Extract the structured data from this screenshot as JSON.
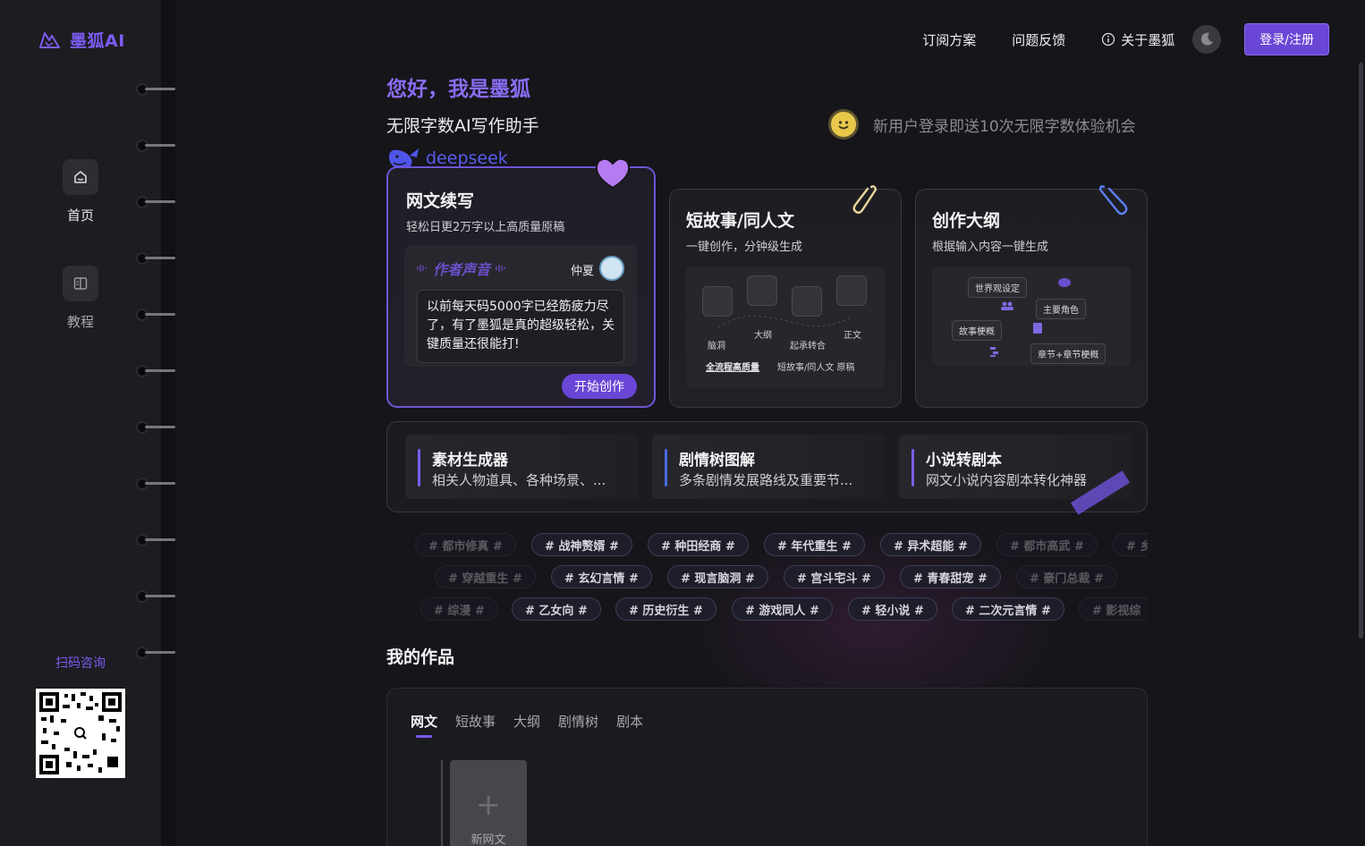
{
  "app": {
    "name": "墨狐AI"
  },
  "sidebar": {
    "items": [
      {
        "label": "首页",
        "icon": "home-icon"
      },
      {
        "label": "教程",
        "icon": "book-icon"
      }
    ],
    "qr_label": "扫码咨询"
  },
  "topnav": {
    "subscribe": "订阅方案",
    "feedback": "问题反馈",
    "about": "关于墨狐",
    "login": "登录/注册"
  },
  "hero": {
    "greeting": "您好，我是墨狐",
    "subtitle": "无限字数AI写作助手",
    "promo": "新用户登录即送10次无限字数体验机会",
    "badge": "deepseek"
  },
  "cards": {
    "webnovel": {
      "title": "网文续写",
      "desc": "轻松日更2万字以上高质量原稿",
      "voice_title": "作者声音",
      "voice_author": "仲夏",
      "voice_quote": "以前每天码5000字已经筋疲力尽了，有了墨狐是真的超级轻松，关键质量还很能打!",
      "start": "开始创作"
    },
    "short": {
      "title": "短故事/同人文",
      "desc": "一键创作，分钟级生成",
      "diagram": {
        "labels": [
          "大纲",
          "正文",
          "脑洞",
          "起承转合"
        ],
        "caption_bold": "全流程高质量",
        "caption": "短故事/同人文 原稿"
      }
    },
    "outline": {
      "title": "创作大纲",
      "desc": "根据输入内容一键生成",
      "diagram": {
        "pills": [
          "世界观设定",
          "主要角色",
          "故事梗概",
          "章节+章节梗概"
        ]
      }
    }
  },
  "tools": [
    {
      "title": "素材生成器",
      "desc": "相关人物道具、各种场景、..."
    },
    {
      "title": "剧情树图解",
      "desc": "多条剧情发展路线及重要节..."
    },
    {
      "title": "小说转剧本",
      "desc": "网文小说内容剧本转化神器"
    }
  ],
  "tags": {
    "row1": [
      "# 都市修真 #",
      "# 战神赘婿 #",
      "# 种田经商 #",
      "# 年代重生 #",
      "# 异术超能 #",
      "# 都市高武 #",
      "# 乡"
    ],
    "row2": [
      "# 穿越重生 #",
      "# 玄幻言情 #",
      "# 现言脑洞 #",
      "# 宫斗宅斗 #",
      "# 青春甜宠 #",
      "# 豪门总裁 #"
    ],
    "row3": [
      "# 综漫 #",
      "# 乙女向 #",
      "# 历史衍生 #",
      "# 游戏同人 #",
      "# 轻小说 #",
      "# 二次元言情 #",
      "# 影视综"
    ]
  },
  "works": {
    "title": "我的作品",
    "tabs": [
      "网文",
      "短故事",
      "大纲",
      "剧情树",
      "剧本"
    ],
    "new_label": "新网文"
  },
  "colors": {
    "accent": "#7c5cf0",
    "button": "#6a46d6",
    "background": "#16151a",
    "sidebar": "#1d1c21"
  }
}
